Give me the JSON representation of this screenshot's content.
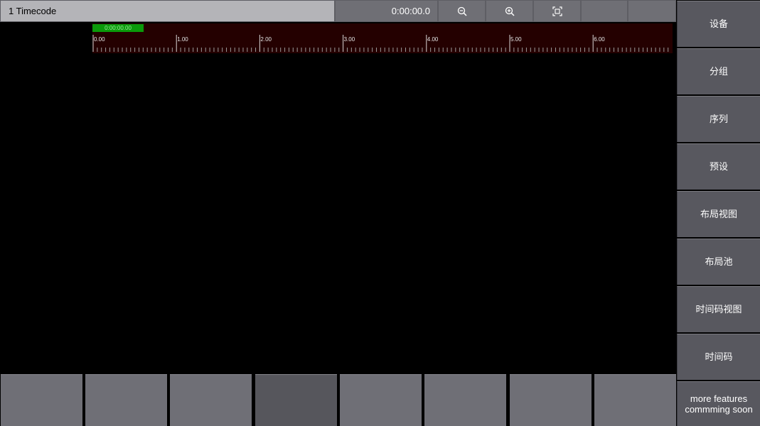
{
  "window": {
    "title": "1 Timecode",
    "time_display": "0:00:00.0"
  },
  "toolbar": {
    "buttons": [
      {
        "name": "zoom-out",
        "icon": "zoom-out-icon"
      },
      {
        "name": "zoom-in",
        "icon": "zoom-in-icon"
      },
      {
        "name": "fit",
        "icon": "fit-view-icon"
      },
      {
        "name": "blank-1",
        "icon": ""
      },
      {
        "name": "blank-2",
        "icon": ""
      }
    ]
  },
  "timeline": {
    "playhead_label": "0:00:00.00",
    "tick_labels": [
      "0.00",
      "1.00",
      "2.00",
      "3.00",
      "4.00",
      "5.00",
      "6.00"
    ],
    "colors": {
      "ruler_bg": "#240000",
      "playhead": "#0a9a0a"
    }
  },
  "sidebar": {
    "items": [
      {
        "label": "设备"
      },
      {
        "label": "分组"
      },
      {
        "label": "序列"
      },
      {
        "label": "预设"
      },
      {
        "label": "布局视图"
      },
      {
        "label": "布局池"
      },
      {
        "label": "时间码视图"
      },
      {
        "label": "时间码"
      },
      {
        "label": "more features commming soon"
      }
    ]
  },
  "bottom_row": {
    "count": 8,
    "active_index": 3
  }
}
